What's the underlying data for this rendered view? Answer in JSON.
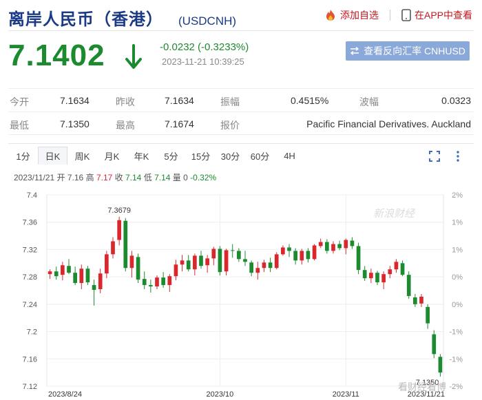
{
  "header": {
    "title": "离岸人民币（香港）",
    "code": "(USDCNH)",
    "add_watch_label": "添加自选",
    "app_view_label": "在APP中查看"
  },
  "quote": {
    "price": "7.1402",
    "change": "-0.0232 (-0.3233%)",
    "timestamp": "2023-11-21 10:39:25",
    "reverse_button_label": "查看反向汇率 CNHUSD"
  },
  "stats": [
    {
      "label": "今开",
      "value": "7.1634"
    },
    {
      "label": "昨收",
      "value": "7.1634"
    },
    {
      "label": "振幅",
      "value": "0.4515%"
    },
    {
      "label": "波幅",
      "value": "0.0323"
    },
    {
      "label": "最低",
      "value": "7.1350"
    },
    {
      "label": "最高",
      "value": "7.1674"
    },
    {
      "label": "报价",
      "value": "Pacific Financial Derivatives. Auckland"
    }
  ],
  "tabs": [
    "1分",
    "日K",
    "周K",
    "月K",
    "年K",
    "5分",
    "15分",
    "30分",
    "60分",
    "4H"
  ],
  "active_tab": "日K",
  "info_line": {
    "date": "2023/11/21",
    "open_label": "开",
    "open": "7.16",
    "high_label": "高",
    "high": "7.17",
    "close_label": "收",
    "close": "7.14",
    "low_label": "低",
    "low": "7.14",
    "vol_label": "量",
    "vol": "0",
    "pct": "-0.32%"
  },
  "colors": {
    "up": "#d9272e",
    "down": "#1c8a2e",
    "brand": "#1a3a86",
    "button": "#8aa8d8"
  },
  "icons": [
    "fire-icon",
    "phone-icon",
    "swap-icon",
    "down-arrow-icon",
    "fullscreen-icon",
    "more-icon"
  ],
  "chart_data": {
    "type": "candlestick",
    "y_left_ticks": [
      "7.4",
      "7.36",
      "7.32",
      "7.28",
      "7.24",
      "7.2",
      "7.16",
      "7.12"
    ],
    "y_right_ticks": [
      "2%",
      "1%",
      "1%",
      "0%",
      "0%",
      "-1%",
      "-1%",
      "-2%"
    ],
    "x_labels": [
      {
        "label": "2023/8/24",
        "index": 0
      },
      {
        "label": "2023/10",
        "index": 27
      },
      {
        "label": "2023/11",
        "index": 47
      },
      {
        "label": "2023/11/21",
        "index": 61
      }
    ],
    "ylim": [
      7.12,
      7.4
    ],
    "max_annotation": "7.3679",
    "min_annotation": "7.1350",
    "watermark": "新浪财经",
    "bottom_watermark": "看财经看博",
    "ohlc": [
      [
        7.284,
        7.291,
        7.277,
        7.288
      ],
      [
        7.288,
        7.295,
        7.276,
        7.281
      ],
      [
        7.283,
        7.302,
        7.275,
        7.297
      ],
      [
        7.296,
        7.306,
        7.284,
        7.286
      ],
      [
        7.286,
        7.295,
        7.268,
        7.271
      ],
      [
        7.271,
        7.298,
        7.262,
        7.292
      ],
      [
        7.292,
        7.296,
        7.268,
        7.272
      ],
      [
        7.268,
        7.276,
        7.238,
        7.261
      ],
      [
        7.262,
        7.292,
        7.256,
        7.285
      ],
      [
        7.285,
        7.318,
        7.278,
        7.313
      ],
      [
        7.313,
        7.338,
        7.307,
        7.332
      ],
      [
        7.334,
        7.368,
        7.326,
        7.363
      ],
      [
        7.362,
        7.366,
        7.288,
        7.293
      ],
      [
        7.293,
        7.318,
        7.279,
        7.311
      ],
      [
        7.309,
        7.314,
        7.271,
        7.276
      ],
      [
        7.277,
        7.288,
        7.262,
        7.268
      ],
      [
        7.268,
        7.276,
        7.257,
        7.266
      ],
      [
        7.266,
        7.282,
        7.262,
        7.279
      ],
      [
        7.279,
        7.287,
        7.264,
        7.268
      ],
      [
        7.268,
        7.284,
        7.258,
        7.281
      ],
      [
        7.281,
        7.305,
        7.275,
        7.298
      ],
      [
        7.298,
        7.312,
        7.288,
        7.304
      ],
      [
        7.304,
        7.312,
        7.288,
        7.291
      ],
      [
        7.291,
        7.314,
        7.282,
        7.311
      ],
      [
        7.311,
        7.318,
        7.292,
        7.296
      ],
      [
        7.297,
        7.312,
        7.286,
        7.307
      ],
      [
        7.307,
        7.324,
        7.297,
        7.321
      ],
      [
        7.321,
        7.325,
        7.282,
        7.287
      ],
      [
        7.288,
        7.321,
        7.282,
        7.319
      ],
      [
        7.319,
        7.328,
        7.308,
        7.318
      ],
      [
        7.318,
        7.322,
        7.302,
        7.306
      ],
      [
        7.306,
        7.318,
        7.296,
        7.302
      ],
      [
        7.301,
        7.304,
        7.281,
        7.286
      ],
      [
        7.286,
        7.302,
        7.276,
        7.293
      ],
      [
        7.293,
        7.305,
        7.287,
        7.301
      ],
      [
        7.301,
        7.308,
        7.287,
        7.293
      ],
      [
        7.293,
        7.316,
        7.291,
        7.313
      ],
      [
        7.313,
        7.326,
        7.311,
        7.323
      ],
      [
        7.323,
        7.328,
        7.309,
        7.318
      ],
      [
        7.318,
        7.322,
        7.298,
        7.304
      ],
      [
        7.304,
        7.321,
        7.298,
        7.318
      ],
      [
        7.318,
        7.322,
        7.301,
        7.306
      ],
      [
        7.306,
        7.328,
        7.304,
        7.326
      ],
      [
        7.325,
        7.336,
        7.322,
        7.331
      ],
      [
        7.331,
        7.335,
        7.314,
        7.318
      ],
      [
        7.318,
        7.332,
        7.314,
        7.328
      ],
      [
        7.328,
        7.333,
        7.319,
        7.322
      ],
      [
        7.322,
        7.336,
        7.313,
        7.334
      ],
      [
        7.333,
        7.338,
        7.321,
        7.325
      ],
      [
        7.325,
        7.33,
        7.284,
        7.29
      ],
      [
        7.29,
        7.296,
        7.274,
        7.278
      ],
      [
        7.278,
        7.292,
        7.271,
        7.286
      ],
      [
        7.286,
        7.289,
        7.268,
        7.272
      ],
      [
        7.272,
        7.288,
        7.262,
        7.284
      ],
      [
        7.284,
        7.296,
        7.278,
        7.291
      ],
      [
        7.291,
        7.306,
        7.286,
        7.302
      ],
      [
        7.3,
        7.304,
        7.281,
        7.283
      ],
      [
        7.283,
        7.288,
        7.248,
        7.252
      ],
      [
        7.25,
        7.255,
        7.236,
        7.24
      ],
      [
        7.241,
        7.255,
        7.236,
        7.251
      ],
      [
        7.236,
        7.24,
        7.204,
        7.212
      ],
      [
        7.196,
        7.202,
        7.161,
        7.167
      ],
      [
        7.163,
        7.167,
        7.134,
        7.14
      ]
    ]
  }
}
